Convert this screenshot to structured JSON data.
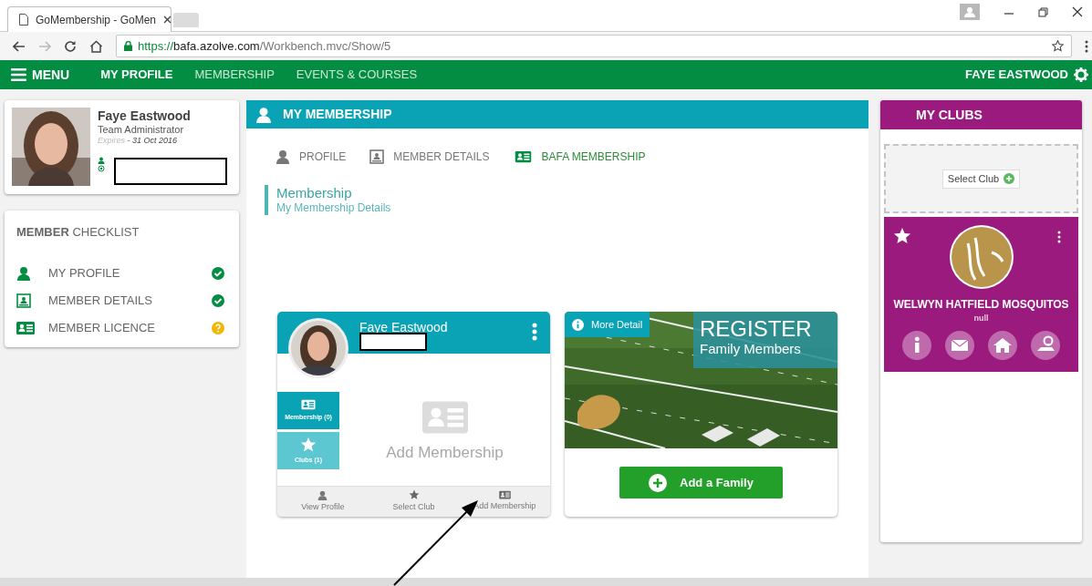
{
  "browser": {
    "tab_title": "GoMembership - GoMen",
    "url": [
      "https://",
      "bafa.azolve.com",
      "/Workbench.mvc/Show/5"
    ]
  },
  "nav": {
    "menu": "MENU",
    "items": [
      {
        "label": "MY PROFILE",
        "selected": true
      },
      {
        "label": "MEMBERSHIP",
        "selected": false
      },
      {
        "label": "EVENTS & COURSES",
        "selected": false
      }
    ],
    "user": "FAYE EASTWOOD"
  },
  "profile": {
    "name": "Faye Eastwood",
    "role": "Team Administrator",
    "expires_label": "Expires",
    "expires_date": "- 31 Oct 2016"
  },
  "checklist": {
    "title": "**MEMBER** CHECKLIST",
    "items": [
      {
        "label": "MY PROFILE",
        "kind": "complete"
      },
      {
        "label": "MEMBER DETAILS",
        "kind": "complete"
      },
      {
        "label": "MEMBER LICENCE",
        "kind": "pending"
      }
    ]
  },
  "membership": {
    "title": "MY MEMBERSHIP",
    "tabs": [
      {
        "label": "PROFILE",
        "selected": false
      },
      {
        "label": "MEMBER DETAILS",
        "selected": false
      },
      {
        "label": "BAFA MEMBERSHIP",
        "selected": true
      }
    ],
    "section_title": "Membership",
    "section_subtitle": "My Membership Details",
    "member_card": {
      "name": "Faye Eastwood",
      "side_buttons": [
        {
          "label": "Membership (0)",
          "selected": true
        },
        {
          "label": "Clubs (1)",
          "selected": false
        }
      ],
      "empty_text": "Add Membership",
      "actions": [
        "View Profile",
        "Select Club",
        "Add Membership"
      ]
    },
    "register_card": {
      "more_detail": "More Detail",
      "title": "REGISTER",
      "subtitle": "Family Members",
      "button": "Add a Family"
    }
  },
  "clubs": {
    "title": "MY CLUBS",
    "select_club": "Select Club",
    "club": {
      "name": "WELWYN HATFIELD MOSQUITOS",
      "subtitle": "null"
    }
  }
}
